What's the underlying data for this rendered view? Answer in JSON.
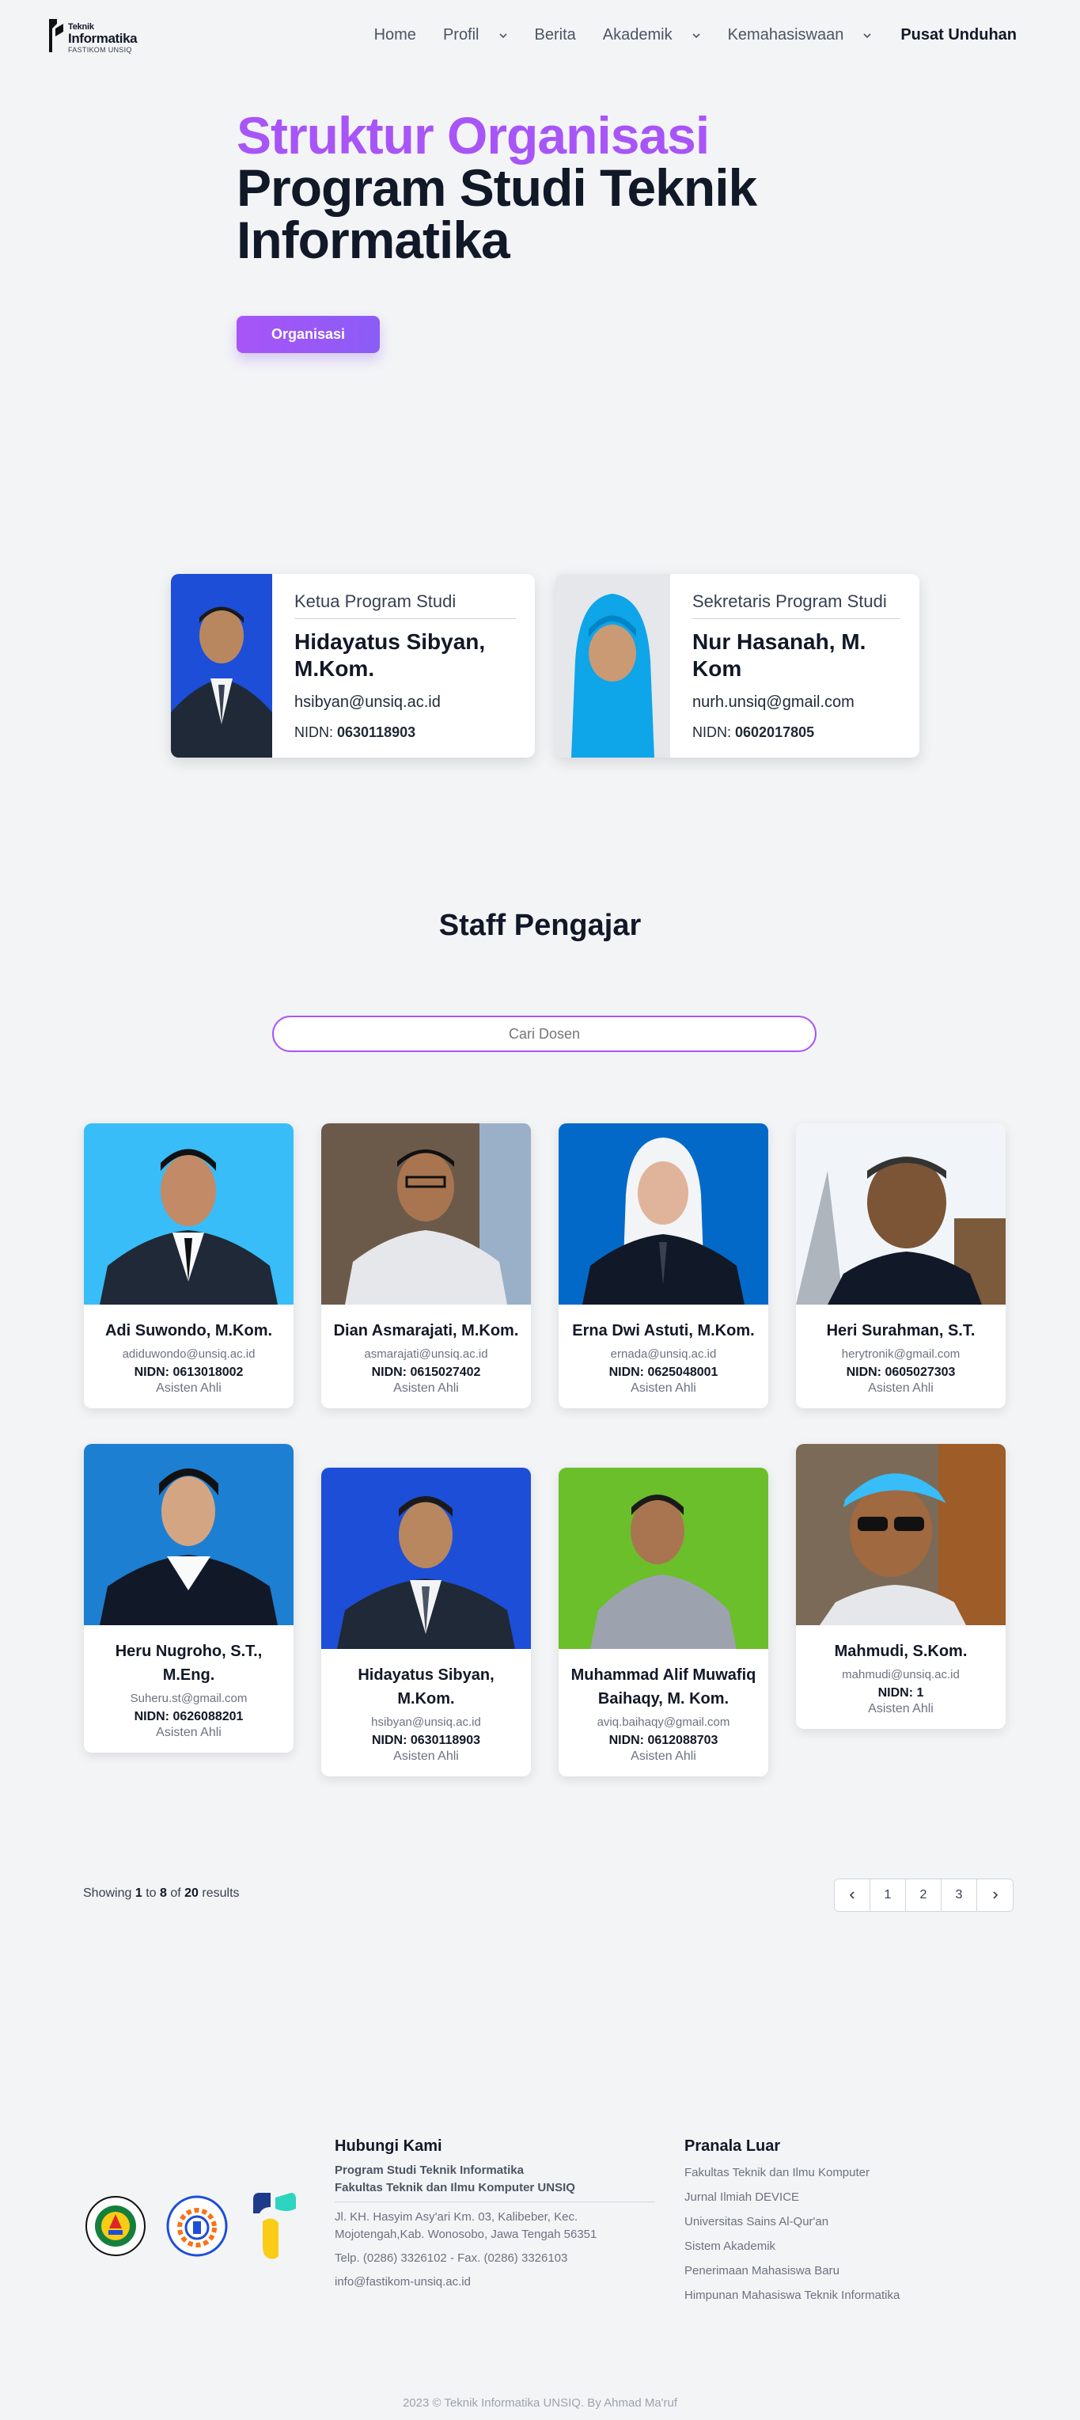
{
  "nav": {
    "logo": {
      "line1": "Teknik",
      "line2": "Informatika",
      "line3": "FASTIKOM UNSIQ"
    },
    "items": [
      {
        "label": "Home",
        "dropdown": false
      },
      {
        "label": "Profil",
        "dropdown": true
      },
      {
        "label": "Berita",
        "dropdown": false
      },
      {
        "label": "Akademik",
        "dropdown": true
      },
      {
        "label": "Kemahasiswaan",
        "dropdown": true
      },
      {
        "label": "Pusat Unduhan",
        "dropdown": false
      }
    ]
  },
  "hero": {
    "title_accent": "Struktur Organisasi",
    "title_line2": "Program Studi Teknik",
    "title_line3": "Informatika",
    "button": "Organisasi"
  },
  "leaders": [
    {
      "role": "Ketua Program Studi",
      "name": "Hidayatus Sibyan, M.Kom.",
      "email": "hsibyan@unsiq.ac.id",
      "nidn_label": "NIDN:",
      "nidn": "0630118903"
    },
    {
      "role": "Sekretaris Program Studi",
      "name": "Nur Hasanah, M. Kom",
      "email": "nurh.unsiq@gmail.com",
      "nidn_label": "NIDN:",
      "nidn": "0602017805"
    }
  ],
  "staff": {
    "title": "Staff Pengajar",
    "search_placeholder": "Cari Dosen",
    "cards": [
      {
        "name": "Adi Suwondo, M.Kom.",
        "email": "adiduwondo@unsiq.ac.id",
        "nidn": "NIDN: 0613018002",
        "rank": "Asisten Ahli"
      },
      {
        "name": "Dian Asmarajati, M.Kom.",
        "email": "asmarajati@unsiq.ac.id",
        "nidn": "NIDN: 0615027402",
        "rank": "Asisten Ahli"
      },
      {
        "name": "Erna Dwi Astuti, M.Kom.",
        "email": "ernada@unsiq.ac.id",
        "nidn": "NIDN: 0625048001",
        "rank": "Asisten Ahli"
      },
      {
        "name": "Heri Surahman, S.T.",
        "email": "herytronik@gmail.com",
        "nidn": "NIDN: 0605027303",
        "rank": "Asisten Ahli"
      },
      {
        "name": "Heru Nugroho, S.T., M.Eng.",
        "email": "Suheru.st@gmail.com",
        "nidn": "NIDN: 0626088201",
        "rank": "Asisten Ahli"
      },
      {
        "name": "Hidayatus Sibyan, M.Kom.",
        "email": "hsibyan@unsiq.ac.id",
        "nidn": "NIDN: 0630118903",
        "rank": "Asisten Ahli"
      },
      {
        "name": "Muhammad Alif Muwafiq Baihaqy, M. Kom.",
        "email": "aviq.baihaqy@gmail.com",
        "nidn": "NIDN: 0612088703",
        "rank": "Asisten Ahli"
      },
      {
        "name": "Mahmudi, S.Kom.",
        "email": "mahmudi@unsiq.ac.id",
        "nidn": "NIDN: 1",
        "rank": "Asisten Ahli"
      }
    ]
  },
  "pagination": {
    "showing": "Showing",
    "from": "1",
    "to_word": "to",
    "to": "8",
    "of_word": "of",
    "total": "20",
    "results": "results",
    "pages": [
      "1",
      "2",
      "3"
    ]
  },
  "footer": {
    "contact_title": "Hubungi Kami",
    "org1": "Program Studi Teknik Informatika",
    "org2": "Fakultas Teknik dan Ilmu Komputer UNSIQ",
    "address": "Jl. KH. Hasyim Asy'ari Km. 03, Kalibeber, Kec. Mojotengah,Kab. Wonosobo, Jawa Tengah 56351",
    "phone": "Telp. (0286) 3326102 - Fax. (0286) 3326103",
    "email": "info@fastikom-unsiq.ac.id",
    "links_title": "Pranala Luar",
    "links": [
      "Fakultas Teknik dan Ilmu Komputer",
      "Jurnal Ilmiah DEVICE",
      "Universitas Sains Al-Qur'an",
      "Sistem Akademik",
      "Penerimaan Mahasiswa Baru",
      "Himpunan Mahasiswa Teknik Informatika"
    ],
    "copyright": "2023 © Teknik Informatika UNSIQ. By Ahmad Ma'ruf"
  },
  "colors": {
    "accent": "#a855f7",
    "text": "#111827",
    "muted": "#6b7280",
    "background": "#f3f4f6"
  }
}
